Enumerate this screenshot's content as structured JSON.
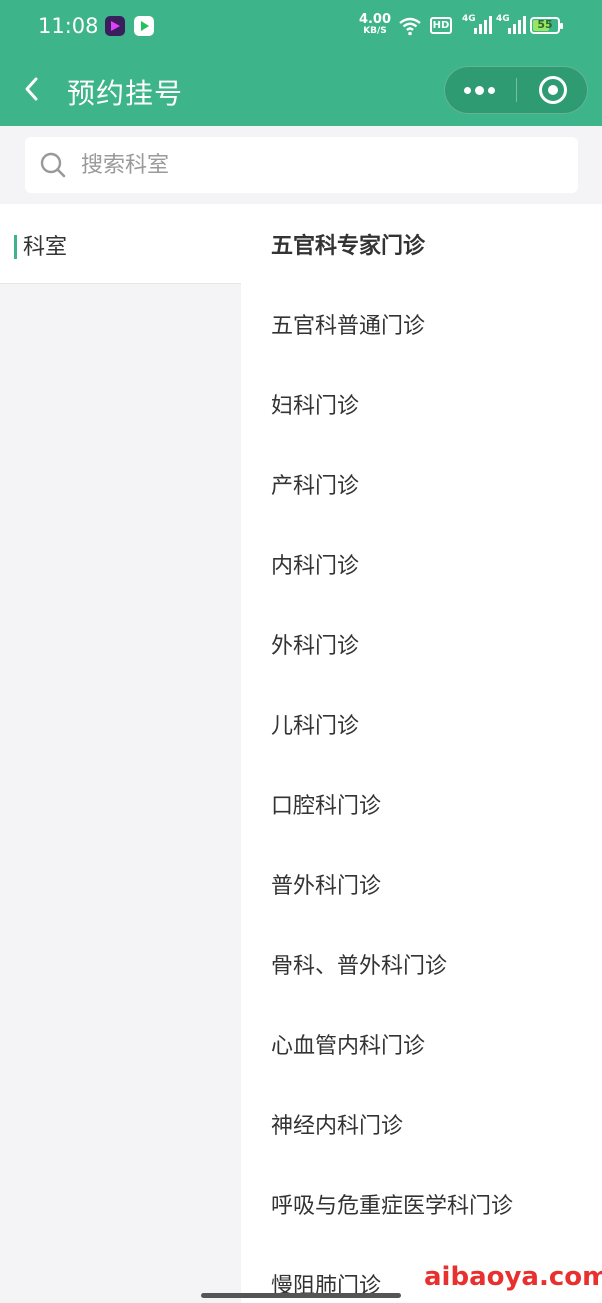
{
  "status_bar": {
    "time": "11:08",
    "net_speed": "4.00",
    "net_unit": "KB/S",
    "hd": "HD",
    "sim1": "4G",
    "sim2": "4G",
    "battery": "55",
    "icons": [
      "video-app-icon",
      "player-app-icon",
      "wifi-icon",
      "hd-icon",
      "signal-icon",
      "signal-icon",
      "battery-icon"
    ]
  },
  "nav": {
    "title": "预约挂号",
    "back_icon": "chevron-left-icon",
    "more_icon": "more-dots-icon",
    "close_icon": "target-icon"
  },
  "search": {
    "placeholder": "搜索科室",
    "icon": "search-icon"
  },
  "left_panel": {
    "category": "科室"
  },
  "departments": [
    "五官科专家门诊",
    "五官科普通门诊",
    "妇科门诊",
    "产科门诊",
    "内科门诊",
    "外科门诊",
    "儿科门诊",
    "口腔科门诊",
    "普外科门诊",
    "骨科、普外科门诊",
    "心血管内科门诊",
    "神经内科门诊",
    "呼吸与危重症医学科门诊",
    "慢阻肺门诊"
  ],
  "watermark": "aibaoya.com",
  "colors": {
    "primary": "#3db489",
    "background": "#f4f4f6",
    "text": "#333333",
    "watermark": "#e8302e"
  }
}
